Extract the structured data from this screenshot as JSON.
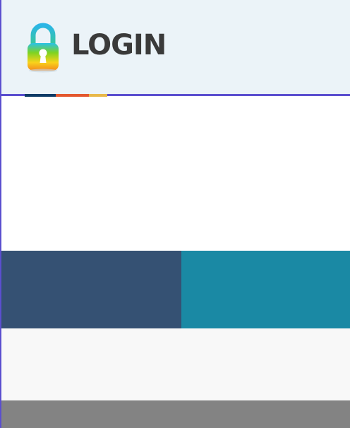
{
  "header": {
    "title": "LOGIN",
    "logo_icon": "padlock-icon",
    "background": "#ebf3f8",
    "rule_color": "#5b4fcf",
    "accent_colors": [
      "#0d3b66",
      "#e4572e",
      "#e8b84a"
    ]
  },
  "panels": {
    "left_color": "#355173",
    "right_color": "#1a89a4"
  },
  "light_bar_color": "#f8f8f8",
  "footer_color": "#838383"
}
